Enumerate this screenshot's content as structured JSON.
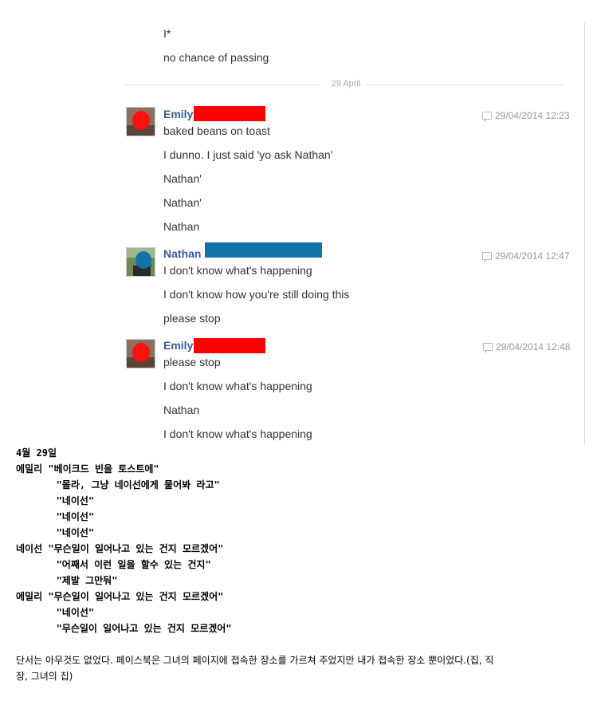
{
  "colors": {
    "redact_emily": "#ff0000",
    "redact_nathan": "#1273a9",
    "sender": "#3b5998"
  },
  "top_messages": [
    "I*",
    "no chance of passing"
  ],
  "date_divider": "29 April",
  "groups": [
    {
      "sender": "Emily",
      "avatar": "emily-avatar",
      "timestamp": "29/04/2014 12:23",
      "messages": [
        "baked beans on toast",
        "I dunno. I just said 'yo ask Nathan'",
        "Nathan'",
        "Nathan'",
        "Nathan"
      ]
    },
    {
      "sender": "Nathan",
      "avatar": "nathan-avatar",
      "timestamp": "29/04/2014 12:47",
      "messages": [
        "I don't know what's happening",
        "I don't know how you're still doing this",
        "please stop"
      ]
    },
    {
      "sender": "Emily",
      "avatar": "emily-avatar",
      "timestamp": "29/04/2014 12:48",
      "messages": [
        "please stop",
        "I don't know what's happening",
        "Nathan",
        "I don't know what's happening"
      ]
    }
  ],
  "translation": {
    "date": "4월 29일",
    "lines": [
      "에밀리 \"베이크드 빈을 토스트에\"",
      "       \"몰라, 그냥 네이선에게 물어봐 라고\"",
      "       \"네이선\"",
      "       \"네이선\"",
      "       \"네이선\"",
      "네이선 \"무슨일이 일어나고 있는 건지 모르겠어\"",
      "       \"어째서 이런 일을 할수 있는 건지\"",
      "       \"제발 그만둬\"",
      "에밀리 \"무슨일이 일어나고 있는 건지 모르겠어\"",
      "       \"네이선\"",
      "       \"무슨일이 일어나고 있는 건지 모르겠어\""
    ]
  },
  "note": "단서는 아무것도 없었다. 페이스북은 그녀의 페이지에 접속한 장소를 가르쳐 주었지만 내가 접속한 장소 뿐이었다.(집, 직장, 그녀의 집)"
}
